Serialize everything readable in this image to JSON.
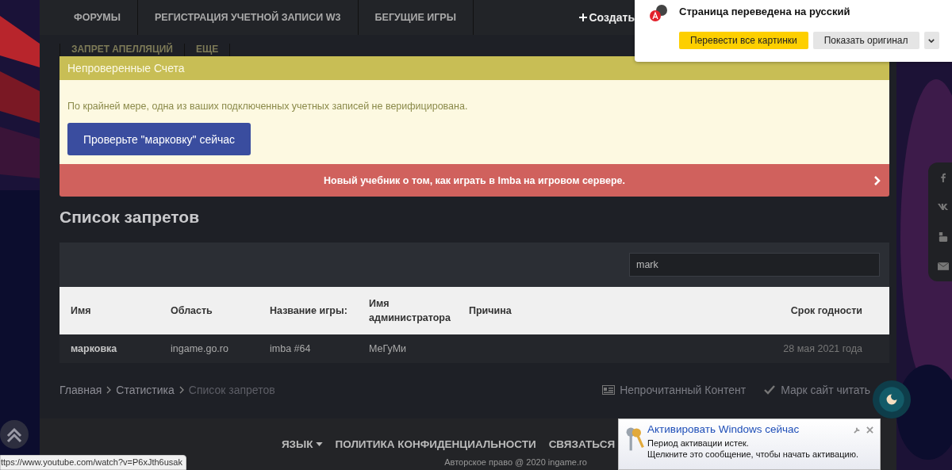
{
  "nav": {
    "items": [
      "ФОРУМЫ",
      "РЕГИСТРАЦИЯ УЧЕТНОЙ ЗАПИСИ W3",
      "БЕГУЩИЕ ИГРЫ"
    ],
    "create": "Создать"
  },
  "subnav": {
    "items": [
      "ЗАПРЕТ АПЕЛЛЯЦИЙ",
      "ЕЩЕ"
    ]
  },
  "notice": {
    "title": "Непроверенные Счета",
    "text": "По крайней мере, одна из ваших подключенных учетных записей не верифицирована.",
    "button": "Проверьте \"марковку\" сейчас"
  },
  "announcement": {
    "text": "Новый учебник о том, как играть в Imba на игровом сервере."
  },
  "page_title": "Список запретов",
  "search": {
    "value": "mark"
  },
  "table": {
    "columns": [
      "Имя",
      "Область",
      "Название игры:",
      "Имя администратора",
      "Причина",
      "Срок годности"
    ],
    "rows": [
      {
        "cells": [
          "марковка",
          "ingame.go.ro",
          "imba #64",
          "МеГуМи",
          "",
          "28 мая 2021 года"
        ]
      }
    ]
  },
  "breadcrumb": [
    {
      "label": "Главная",
      "current": false
    },
    {
      "label": "Статистика",
      "current": false
    },
    {
      "label": "Список запретов",
      "current": true
    }
  ],
  "footer_actions": [
    "Непрочитанный Контент",
    "Марк сайт читать"
  ],
  "footer": {
    "links": [
      {
        "label": "ЯЗЫК",
        "dropdown": true
      },
      {
        "label": "ПОЛИТИКА КОНФИДЕНЦИАЛЬНОСТИ",
        "dropdown": false
      },
      {
        "label": "СВЯЗАТЬСЯ",
        "dropdown": false
      }
    ],
    "copyright": "Авторское право @ 2020 ingame.ro"
  },
  "translate_popup": {
    "title": "Страница переведена на русский",
    "primary": "Перевести все картинки",
    "secondary": "Показать оригинал"
  },
  "windows_popup": {
    "title": "Активировать Windows сейчас",
    "lines": [
      "Период активации истек.",
      "Щелкните это сообщение, чтобы начать активацию."
    ]
  },
  "status_url": "ttps://www.youtube.com/watch?v=P6xJth6usak"
}
